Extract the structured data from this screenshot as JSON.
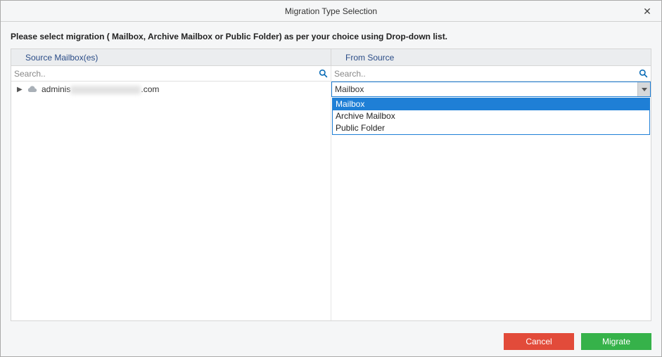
{
  "window": {
    "title": "Migration Type Selection"
  },
  "instruction": "Please select migration ( Mailbox, Archive Mailbox or Public Folder) as per your choice using Drop-down list.",
  "columns": {
    "left_header": "Source Mailbox(es)",
    "right_header": "From Source"
  },
  "search": {
    "left_placeholder": "Search..",
    "right_placeholder": "Search.."
  },
  "tree": {
    "item_prefix": "adminis",
    "item_suffix": ".com"
  },
  "combo": {
    "selected": "Mailbox",
    "options": [
      "Mailbox",
      "Archive Mailbox",
      "Public Folder"
    ]
  },
  "buttons": {
    "cancel": "Cancel",
    "migrate": "Migrate"
  }
}
